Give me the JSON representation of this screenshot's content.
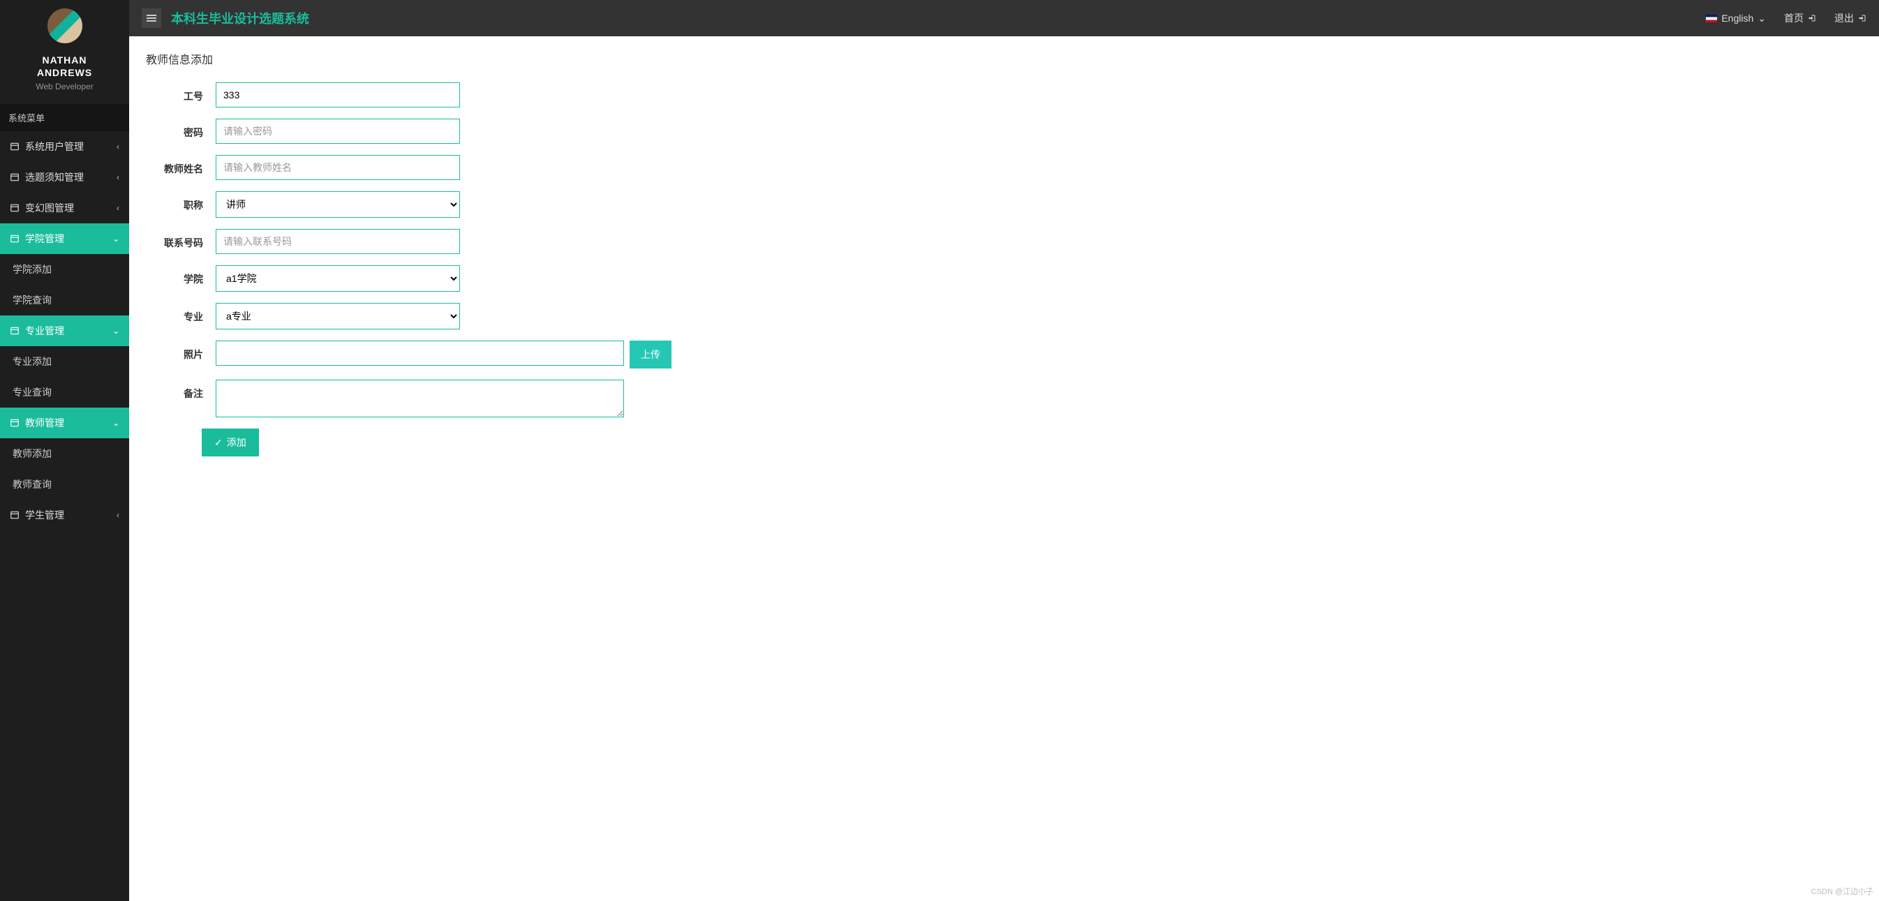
{
  "profile": {
    "name_line1": "NATHAN",
    "name_line2": "ANDREWS",
    "role": "Web Developer"
  },
  "sidebar": {
    "menu_title": "系统菜单",
    "items": [
      {
        "label": "系统用户管理",
        "active": false,
        "expanded": false
      },
      {
        "label": "选题须知管理",
        "active": false,
        "expanded": false
      },
      {
        "label": "变幻图管理",
        "active": false,
        "expanded": false
      },
      {
        "label": "学院管理",
        "active": true,
        "expanded": true,
        "children": [
          "学院添加",
          "学院查询"
        ]
      },
      {
        "label": "专业管理",
        "active": true,
        "expanded": true,
        "children": [
          "专业添加",
          "专业查询"
        ]
      },
      {
        "label": "教师管理",
        "active": true,
        "expanded": true,
        "children": [
          "教师添加",
          "教师查询"
        ]
      },
      {
        "label": "学生管理",
        "active": false,
        "expanded": false
      }
    ]
  },
  "topbar": {
    "app_title": "本科生毕业设计选题系统",
    "lang_label": "English",
    "home_label": "首页",
    "logout_label": "退出"
  },
  "page": {
    "title": "教师信息添加"
  },
  "form": {
    "job_no": {
      "label": "工号",
      "value": "333"
    },
    "password": {
      "label": "密码",
      "placeholder": "请输入密码"
    },
    "name": {
      "label": "教师姓名",
      "placeholder": "请输入教师姓名"
    },
    "title": {
      "label": "职称",
      "selected": "讲师"
    },
    "phone": {
      "label": "联系号码",
      "placeholder": "请输入联系号码"
    },
    "college": {
      "label": "学院",
      "selected": "a1学院"
    },
    "major": {
      "label": "专业",
      "selected": "a专业"
    },
    "photo": {
      "label": "照片",
      "upload_btn": "上传"
    },
    "remark": {
      "label": "备注"
    },
    "submit": {
      "label": "添加"
    }
  },
  "watermark": "CSDN @江边小子"
}
